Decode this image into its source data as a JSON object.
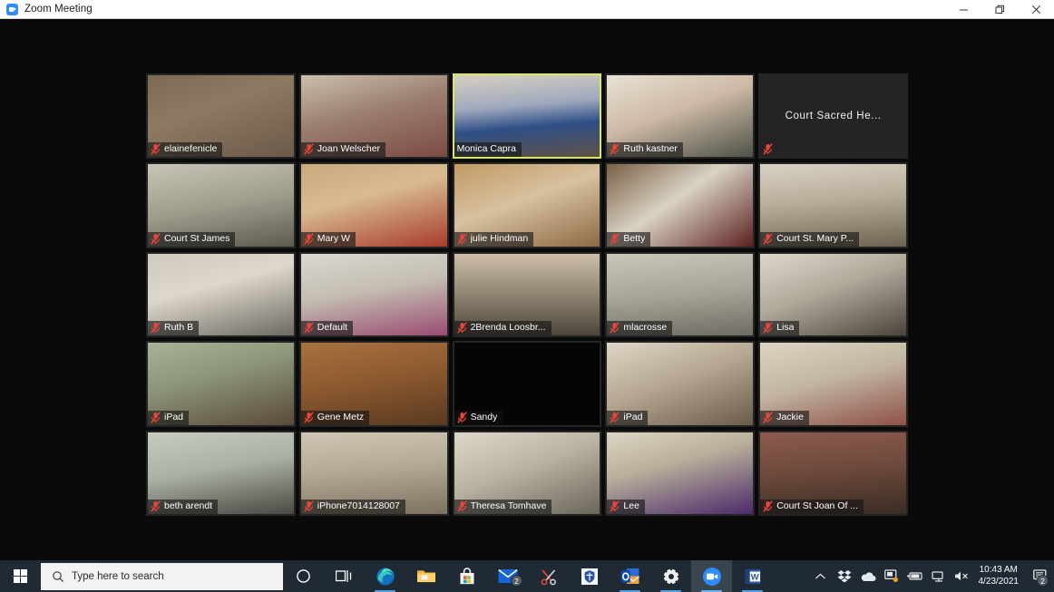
{
  "window": {
    "title": "Zoom Meeting",
    "app_icon": "zoom-camera-icon",
    "controls": {
      "minimize": "minimize-icon",
      "restore": "restore-icon",
      "close": "close-icon"
    }
  },
  "meeting": {
    "layout": "gallery-grid",
    "columns": 5,
    "rows": 5,
    "active_speaker_border_color": "#d9e94e",
    "no_video_background": "#242424",
    "mute_icon_color": "#e8453c",
    "participants": [
      {
        "name": "elainefenicle",
        "muted": true,
        "video": true,
        "speaking": false,
        "bg": "linear-gradient(160deg,#7d6a55 0%,#8d7a62 40%,#6b5a48 100%)"
      },
      {
        "name": "Joan Welscher",
        "muted": true,
        "video": true,
        "speaking": false,
        "bg": "linear-gradient(165deg,#cbbfae 0%,#9b7f70 45%,#7c4b42 100%)"
      },
      {
        "name": "Monica Capra",
        "muted": false,
        "video": true,
        "speaking": true,
        "bg": "linear-gradient(175deg,#d8cfc2 0%,#9fa9bd 38%,#2f4f86 62%,#5e5248 100%)"
      },
      {
        "name": "Ruth kastner",
        "muted": true,
        "video": true,
        "speaking": false,
        "bg": "linear-gradient(160deg,#e8e2d4 0%,#cdb9a5 45%,#4d5247 100%)"
      },
      {
        "name": "Court Sacred He...",
        "muted": true,
        "video": false,
        "speaking": false,
        "bg": "#242424"
      },
      {
        "name": "Court St James",
        "muted": true,
        "video": true,
        "speaking": false,
        "bg": "linear-gradient(170deg,#c9c5b6 0%,#a09c8c 50%,#5d5a50 100%)"
      },
      {
        "name": "Mary W",
        "muted": true,
        "video": true,
        "speaking": false,
        "bg": "linear-gradient(165deg,#c9a97c 0%,#d8bb91 40%,#a83b2c 100%)"
      },
      {
        "name": "julie Hindman",
        "muted": true,
        "video": true,
        "speaking": false,
        "bg": "linear-gradient(160deg,#c29a63 0%,#d7c1a0 45%,#8d6a45 100%)"
      },
      {
        "name": "Betty",
        "muted": true,
        "video": true,
        "speaking": false,
        "bg": "linear-gradient(145deg,#7a5f45 0%,#d9d3c4 45%,#5c2020 100%)"
      },
      {
        "name": "Court St. Mary P...",
        "muted": true,
        "video": true,
        "speaking": false,
        "bg": "linear-gradient(175deg,#d9d2c4 0%,#b8ac99 45%,#6e6352 100%)"
      },
      {
        "name": "Ruth B",
        "muted": true,
        "video": true,
        "speaking": false,
        "bg": "linear-gradient(165deg,#cfc9be 0%,#ded7cb 40%,#6d6a63 100%)"
      },
      {
        "name": "Default",
        "muted": true,
        "video": true,
        "speaking": false,
        "bg": "linear-gradient(170deg,#dcd8d0 0%,#c3bdb2 45%,#9a4c72 100%)"
      },
      {
        "name": "2Brenda Loosbr...",
        "muted": true,
        "video": true,
        "speaking": false,
        "bg": "linear-gradient(180deg,#cdbfa8 0%,#8f8472 50%,#4c463b 100%)"
      },
      {
        "name": "mlacrosse",
        "muted": true,
        "video": true,
        "speaking": false,
        "bg": "linear-gradient(175deg,#c9c6bb 0%,#a6a398 50%,#6f6d63 100%)"
      },
      {
        "name": "Lisa",
        "muted": true,
        "video": true,
        "speaking": false,
        "bg": "linear-gradient(160deg,#ded8cc 0%,#b0a99a 45%,#4a443c 100%)"
      },
      {
        "name": "iPad",
        "muted": true,
        "video": true,
        "speaking": false,
        "bg": "linear-gradient(165deg,#a8b296 0%,#8d9679 40%,#5a4a3a 100%)"
      },
      {
        "name": "Gene Metz",
        "muted": true,
        "video": true,
        "speaking": false,
        "bg": "linear-gradient(170deg,#a9713f 0%,#8d5a30 45%,#5a3a20 100%)"
      },
      {
        "name": "Sandy",
        "muted": true,
        "video": true,
        "speaking": false,
        "bg": "#050505"
      },
      {
        "name": "iPad",
        "muted": true,
        "video": true,
        "speaking": false,
        "bg": "linear-gradient(160deg,#ded6c6 0%,#b6a892 45%,#6b5c4a 100%)"
      },
      {
        "name": "Jackie",
        "muted": true,
        "video": true,
        "speaking": false,
        "bg": "linear-gradient(165deg,#ded4c2 0%,#c2b6a2 45%,#8e5048 100%)"
      },
      {
        "name": "beth arendt",
        "muted": true,
        "video": true,
        "speaking": false,
        "bg": "linear-gradient(170deg,#c6ccc0 0%,#aab0a4 45%,#4a4842 100%)"
      },
      {
        "name": "iPhone7014128007",
        "muted": true,
        "video": true,
        "speaking": false,
        "bg": "linear-gradient(175deg,#cfc6b5 0%,#b4a995 45%,#7d725f 100%)"
      },
      {
        "name": "Theresa Tomhave",
        "muted": true,
        "video": true,
        "speaking": false,
        "bg": "linear-gradient(160deg,#ddd8c9 0%,#b9b3a2 45%,#6b665a 100%)"
      },
      {
        "name": "Lee",
        "muted": true,
        "video": true,
        "speaking": false,
        "bg": "linear-gradient(165deg,#ddd6c4 0%,#b8ae9a 40%,#4b2a6b 100%)"
      },
      {
        "name": "Court St Joan Of ...",
        "muted": true,
        "video": true,
        "speaking": false,
        "bg": "linear-gradient(175deg,#8d5a4e 0%,#6e4a3c 45%,#3b2c24 100%)"
      }
    ]
  },
  "taskbar": {
    "start_label": "start-button",
    "search": {
      "placeholder": "Type here to search",
      "icon": "search-icon"
    },
    "items": [
      {
        "name": "cortana-icon",
        "label": "Cortana",
        "state": "idle",
        "badge": ""
      },
      {
        "name": "task-view-icon",
        "label": "Task View",
        "state": "idle",
        "badge": ""
      },
      {
        "name": "microsoft-edge-icon",
        "label": "Microsoft Edge",
        "state": "running",
        "badge": ""
      },
      {
        "name": "file-explorer-icon",
        "label": "File Explorer",
        "state": "idle",
        "badge": ""
      },
      {
        "name": "microsoft-store-icon",
        "label": "Microsoft Store",
        "state": "idle",
        "badge": ""
      },
      {
        "name": "mail-icon",
        "label": "Mail",
        "state": "idle",
        "badge": "2"
      },
      {
        "name": "snip-and-sketch-icon",
        "label": "Snip & Sketch",
        "state": "idle",
        "badge": ""
      },
      {
        "name": "shield-app-icon",
        "label": "Security",
        "state": "idle",
        "badge": ""
      },
      {
        "name": "outlook-icon",
        "label": "Outlook",
        "state": "running",
        "badge": ""
      },
      {
        "name": "settings-gear-icon",
        "label": "Settings",
        "state": "running",
        "badge": ""
      },
      {
        "name": "zoom-icon",
        "label": "Zoom Meeting",
        "state": "active",
        "badge": ""
      },
      {
        "name": "word-icon",
        "label": "Microsoft Word",
        "state": "running",
        "badge": ""
      }
    ],
    "tray": [
      {
        "name": "show-hidden-icons-chevron",
        "label": "Show hidden icons"
      },
      {
        "name": "dropbox-icon",
        "label": "Dropbox"
      },
      {
        "name": "onedrive-icon",
        "label": "OneDrive"
      },
      {
        "name": "display-settings-icon",
        "label": "Display"
      },
      {
        "name": "battery-icon",
        "label": "Battery"
      },
      {
        "name": "network-icon",
        "label": "Network"
      },
      {
        "name": "volume-muted-icon",
        "label": "Volume muted"
      }
    ],
    "clock": {
      "time": "10:43 AM",
      "date": "4/23/2021"
    },
    "notifications": {
      "icon": "action-center-icon",
      "badge": "2"
    }
  }
}
